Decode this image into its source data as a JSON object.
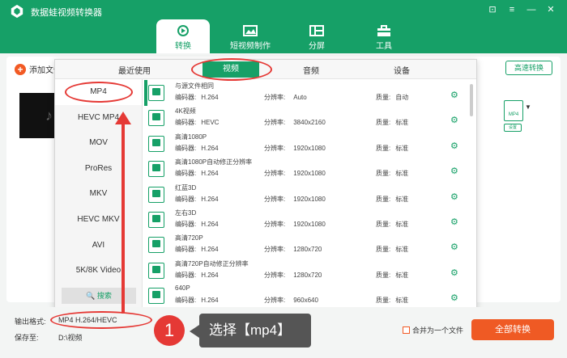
{
  "app": {
    "title": "数据蛙视频转换器",
    "window_buttons": [
      "⊡",
      "≡",
      "—",
      "✕"
    ]
  },
  "nav": [
    {
      "label": "转换",
      "active": true
    },
    {
      "label": "短视频制作",
      "active": false
    },
    {
      "label": "分屏",
      "active": false
    },
    {
      "label": "工具",
      "active": false
    }
  ],
  "toolbar": {
    "add_file": "添加文件",
    "high_speed": "高速转换",
    "setting": "设置",
    "mp4_badge": "MP4"
  },
  "popup": {
    "tabs": [
      "最近使用",
      "视频",
      "音频",
      "设备"
    ],
    "active_tab": "视频",
    "formats": [
      "MP4",
      "HEVC MP4",
      "MOV",
      "ProRes",
      "MKV",
      "HEVC MKV",
      "AVI",
      "5K/8K Video"
    ],
    "selected_format": "MP4",
    "search": "搜索",
    "presets": [
      {
        "name": "与源文件相同",
        "codec": "H.264",
        "res": "Auto",
        "quality": "自动"
      },
      {
        "name": "4K视频",
        "codec": "HEVC",
        "res": "3840x2160",
        "quality": "标准"
      },
      {
        "name": "高清1080P",
        "codec": "H.264",
        "res": "1920x1080",
        "quality": "标准"
      },
      {
        "name": "高清1080P自动修正分辨率",
        "codec": "H.264",
        "res": "1920x1080",
        "quality": "标准"
      },
      {
        "name": "红蓝3D",
        "codec": "H.264",
        "res": "1920x1080",
        "quality": "标准"
      },
      {
        "name": "左右3D",
        "codec": "H.264",
        "res": "1920x1080",
        "quality": "标准"
      },
      {
        "name": "高清720P",
        "codec": "H.264",
        "res": "1280x720",
        "quality": "标准"
      },
      {
        "name": "高清720P自动修正分辨率",
        "codec": "H.264",
        "res": "1280x720",
        "quality": "标准"
      },
      {
        "name": "640P",
        "codec": "H.264",
        "res": "960x640",
        "quality": "标准"
      }
    ],
    "codec_label": "编码器:",
    "res_label": "分辨率:",
    "quality_label": "质量:"
  },
  "bottom": {
    "output_label": "输出格式:",
    "output_value": "MP4 H.264/HEVC",
    "save_label": "保存至:",
    "save_value": "D:\\视频",
    "merge": "合并为一个文件",
    "convert_all": "全部转换"
  },
  "annotation": {
    "step_number": "1",
    "callout": "选择【mp4】"
  },
  "colors": {
    "brand": "#16a067",
    "accent": "#ef5a24",
    "annotation": "#e53935"
  }
}
